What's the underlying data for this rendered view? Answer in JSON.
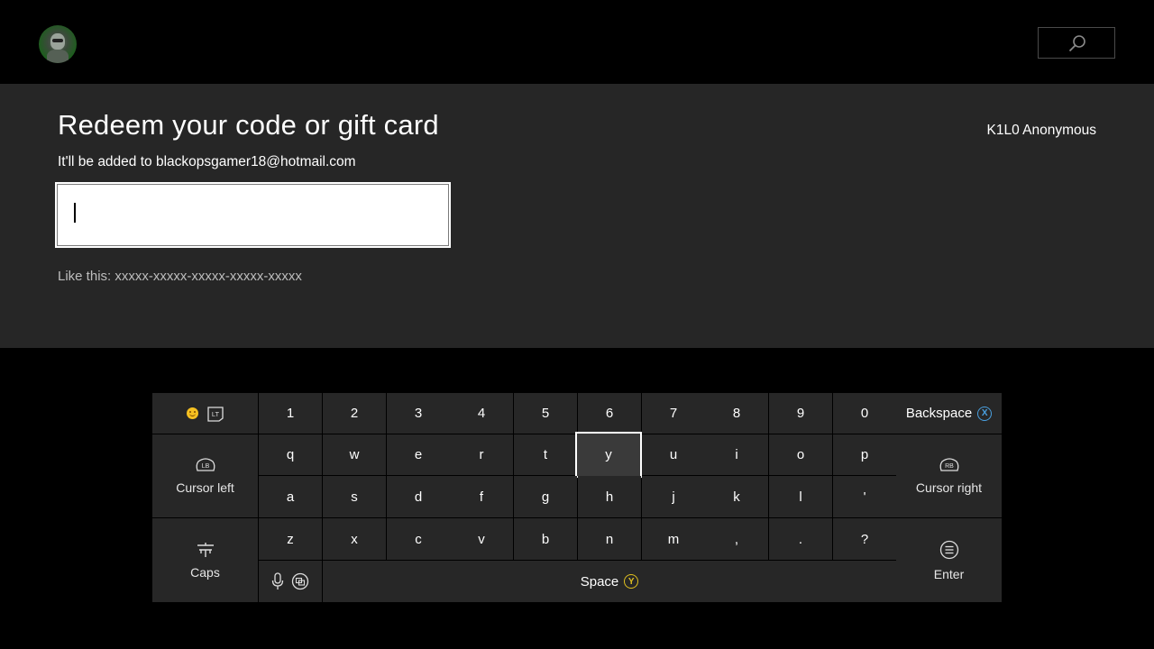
{
  "header": {
    "avatar_icon": "gamer-avatar",
    "search_icon": "search-icon"
  },
  "redeem": {
    "title": "Redeem your code or gift card",
    "subtitle": "It'll be added to blackopsgamer18@hotmail.com",
    "input_value": "",
    "hint": "Like this: xxxxx-xxxxx-xxxxx-xxxxx-xxxxx",
    "gamertag": "K1L0 Anonymous"
  },
  "keyboard": {
    "number_row": [
      "1",
      "2",
      "3",
      "4",
      "5",
      "6",
      "7",
      "8",
      "9",
      "0"
    ],
    "row_q": [
      "q",
      "w",
      "e",
      "r",
      "t",
      "y",
      "u",
      "i",
      "o",
      "p"
    ],
    "row_a": [
      "a",
      "s",
      "d",
      "f",
      "g",
      "h",
      "j",
      "k",
      "l",
      "'"
    ],
    "row_z": [
      "z",
      "x",
      "c",
      "v",
      "b",
      "n",
      "m",
      ",",
      ".",
      "?"
    ],
    "selected_key": "y",
    "emoji_trigger": "LT",
    "backspace_label": "Backspace",
    "backspace_button": "X",
    "cursor_left_label": "Cursor left",
    "cursor_left_button": "LB",
    "cursor_right_label": "Cursor right",
    "cursor_right_button": "RB",
    "caps_label": "Caps",
    "enter_label": "Enter",
    "space_label": "Space",
    "space_button": "Y"
  },
  "colors": {
    "panel_bg": "#262626",
    "key_bg": "#272727",
    "x_button": "#4aa0e0",
    "y_button": "#e0c020"
  }
}
